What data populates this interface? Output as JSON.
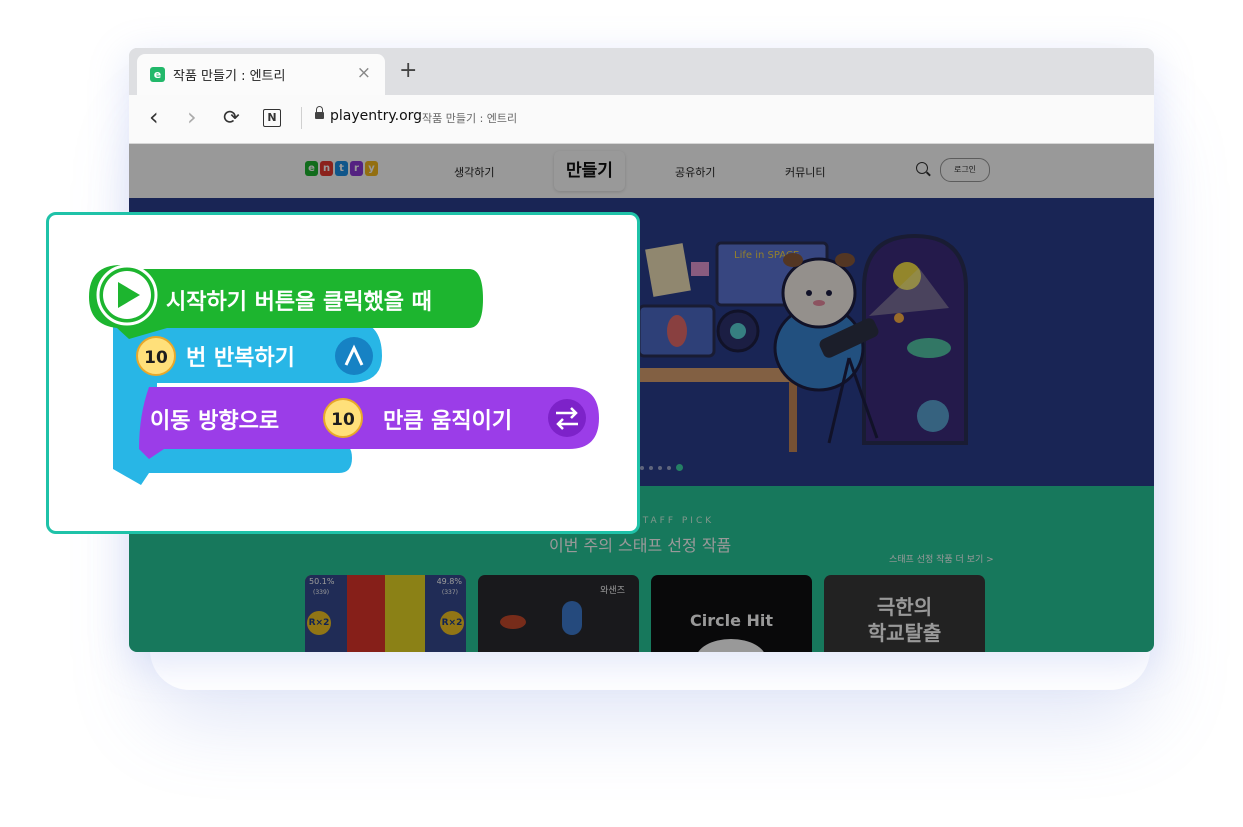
{
  "browser": {
    "tab": {
      "favicon_letter": "e",
      "title": "작품 만들기 : 엔트리",
      "close": "×"
    },
    "new_tab": "+",
    "nav": {
      "back": "‹",
      "forward": "›",
      "reload": "⟳",
      "reader": "N"
    },
    "url": {
      "domain": "playentry.org",
      "page_title": "작품 만들기 : 엔트리"
    }
  },
  "site": {
    "logo_letters": [
      "e",
      "n",
      "t",
      "r",
      "y"
    ],
    "nav": [
      "생각하기",
      "만들기",
      "공유하기",
      "커뮤니티"
    ],
    "login": "로그인",
    "hero": {
      "poster_text": "Life in SPACE"
    },
    "pick": {
      "label": "STAFF PICK",
      "title": "이번 주의 스태프 선정 작품",
      "more": "스태프 선정 작품 더 보기 >"
    },
    "cards": [
      {
        "left_pct": "50.1%",
        "left_count": "(339)",
        "right_pct": "49.8%",
        "right_count": "(337)",
        "badge": "R×2"
      },
      {
        "tag": "와샌즈"
      },
      {
        "title": "Circle Hit"
      },
      {
        "title_line1": "극한의",
        "title_line2": "학교탈출"
      }
    ]
  },
  "blocks": {
    "start": "시작하기 버튼을 클릭했을 때",
    "repeat_count": "10",
    "repeat": "번 반복하기",
    "move_prefix": "이동 방향으로",
    "move_count": "10",
    "move_suffix": "만큼 움직이기"
  },
  "colors": {
    "start": "#1db52f",
    "repeat": "#28b6e6",
    "move": "#9b3de8",
    "popup_border": "#1fc2a8"
  }
}
